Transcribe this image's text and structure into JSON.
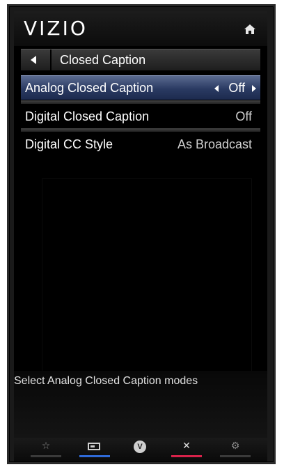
{
  "header": {
    "logo": "VIZIO",
    "home_icon": "home-icon"
  },
  "title_bar": {
    "title": "Closed Caption",
    "back_icon": "back-arrow-icon"
  },
  "menu": {
    "items": [
      {
        "label": "Analog Closed Caption",
        "value": "Off",
        "selected": true
      },
      {
        "label": "Digital Closed Caption",
        "value": "Off",
        "selected": false
      },
      {
        "label": "Digital CC Style",
        "value": "As Broadcast",
        "selected": false
      }
    ]
  },
  "help": {
    "text": "Select Analog Closed Caption modes"
  },
  "footer": {
    "buttons": [
      {
        "icon": "star-icon",
        "glyph": "☆",
        "color": "#4a4a4a"
      },
      {
        "icon": "input-icon",
        "glyph": "",
        "color": "#2f6ad8"
      },
      {
        "icon": "v-logo-icon",
        "glyph": "V",
        "color": "#3a3a3a"
      },
      {
        "icon": "close-icon",
        "glyph": "✕",
        "color": "#d8224a"
      },
      {
        "icon": "gear-icon",
        "glyph": "⚙",
        "color": "#4a4a4a"
      }
    ]
  },
  "colors": {
    "selected_row": "#2a3a62",
    "background": "#000000",
    "text": "#ffffff"
  }
}
